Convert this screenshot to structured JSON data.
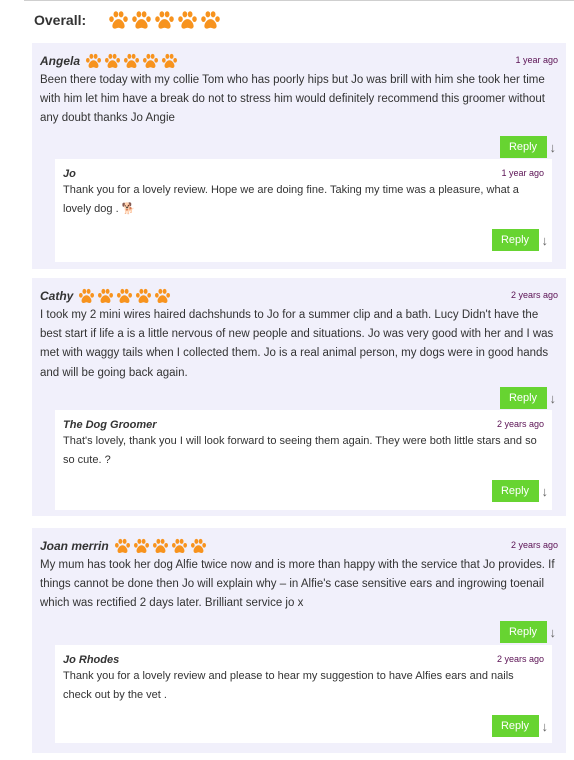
{
  "overall": {
    "label": "Overall:",
    "rating": 5
  },
  "reviews": [
    {
      "author": "Angela",
      "rating": 5,
      "time": "1 year ago",
      "text": "Been there today with my collie Tom who has poorly hips but Jo was brill with him she took her time with him let him have a break do not to stress him would definitely recommend this groomer without any doubt thanks Jo Angie",
      "reply_label": "Reply",
      "reply": {
        "author": "Jo",
        "time": "1 year ago",
        "text": "Thank you for a lovely review. Hope we are doing fine. Taking my time was a pleasure, what a lovely dog . 🐕",
        "reply_label": "Reply"
      }
    },
    {
      "author": "Cathy",
      "rating": 5,
      "time": "2 years ago",
      "text": "I took my 2 mini wires haired dachshunds to Jo for a summer clip and a bath. Lucy Didn't have the best start if life a is a little nervous of new people and situations. Jo was very good with her and I was met with waggy tails when I collected them. Jo is a real animal person, my dogs were in good hands and will be going back again.",
      "reply_label": "Reply",
      "reply": {
        "author": "The Dog Groomer",
        "time": "2 years ago",
        "text": "That's lovely, thank you I will look forward to seeing them again. They were both little stars and so so cute. ?",
        "reply_label": "Reply"
      }
    },
    {
      "author": "Joan merrin",
      "rating": 5,
      "time": "2 years ago",
      "text": "My mum has took her dog Alfie twice now and is more than happy with the service that Jo provides. If things cannot be done then Jo will explain why – in Alfie's case sensitive ears and ingrowing toenail which was rectified 2 days later. Brilliant service jo x",
      "reply_label": "Reply",
      "reply": {
        "author": "Jo Rhodes",
        "time": "2 years ago",
        "text": "Thank you for a lovely review and please to hear my suggestion to have Alfies ears and nails check out by the vet .",
        "reply_label": "Reply"
      }
    }
  ],
  "icons": {
    "paw": "paw-icon",
    "arrow": "down-arrow-icon"
  },
  "colors": {
    "paw": "#f7931e",
    "reply_button": "#67d431",
    "card_bg": "#f1f0fb",
    "timestamp": "#5b1254"
  }
}
